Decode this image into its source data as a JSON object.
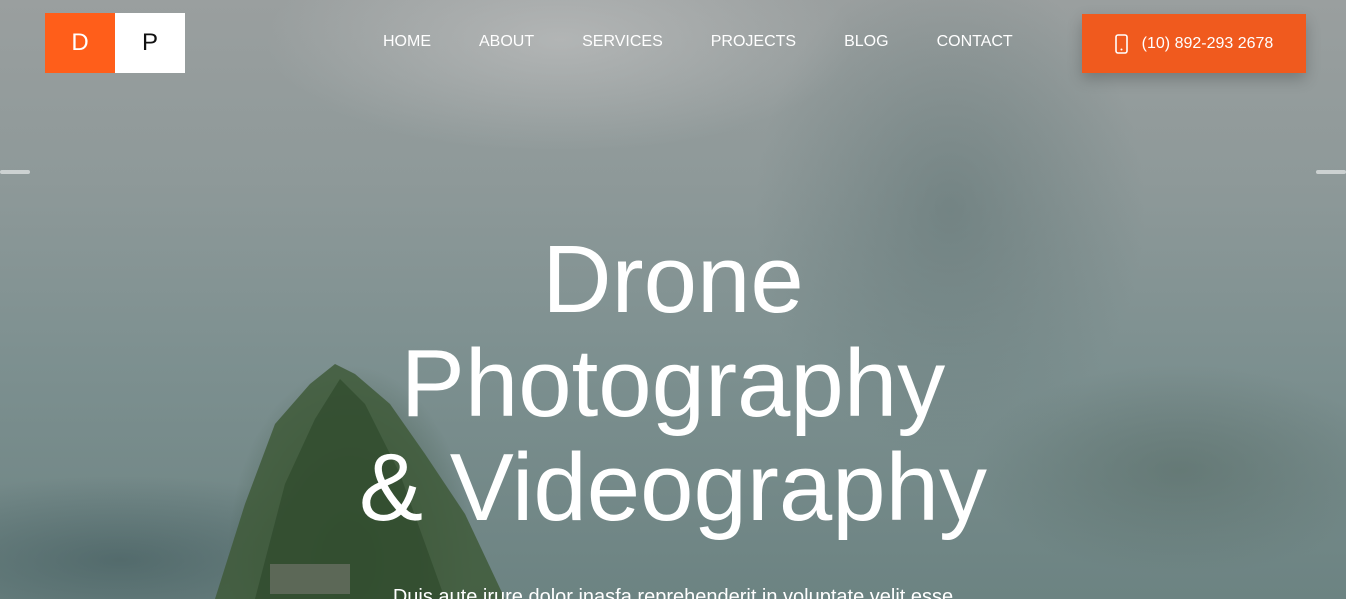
{
  "brand": {
    "logo_left": "D",
    "logo_right": "P",
    "accent_color": "#ff5e1a"
  },
  "nav": {
    "items": [
      {
        "label": "HOME"
      },
      {
        "label": "ABOUT"
      },
      {
        "label": "SERVICES"
      },
      {
        "label": "PROJECTS"
      },
      {
        "label": "BLOG"
      },
      {
        "label": "CONTACT"
      }
    ]
  },
  "header": {
    "phone_label": "(10) 892-293 2678",
    "phone_icon": "mobile-phone-icon",
    "phone_button_color": "#f05a1e"
  },
  "hero": {
    "title_line1": "Drone",
    "title_line2": "Photography",
    "title_line3": "& Videography",
    "subtitle": "Duis aute irure dolor inasfa reprehenderit in voluptate velit esse"
  }
}
